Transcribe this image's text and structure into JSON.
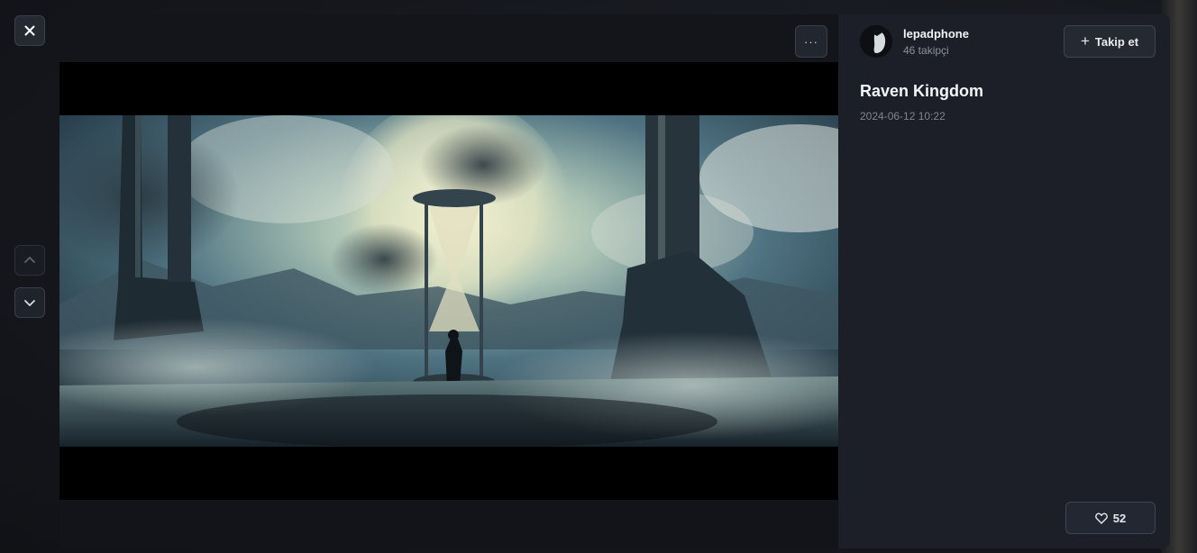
{
  "controls": {
    "close_icon": "close-icon",
    "prev_icon": "chevron-up-icon",
    "next_icon": "chevron-down-icon",
    "more_label": "···"
  },
  "author": {
    "name": "lepadphone",
    "followers": "46 takipçi",
    "follow_label": "Takip et"
  },
  "post": {
    "title": "Raven Kingdom",
    "date": "2024-06-12 10:22",
    "likes": "52"
  },
  "colors": {
    "panel_bg": "#1c1f27",
    "viewer_bg": "#111319",
    "text_primary": "#f1f3f6",
    "text_muted": "#8a909c"
  }
}
